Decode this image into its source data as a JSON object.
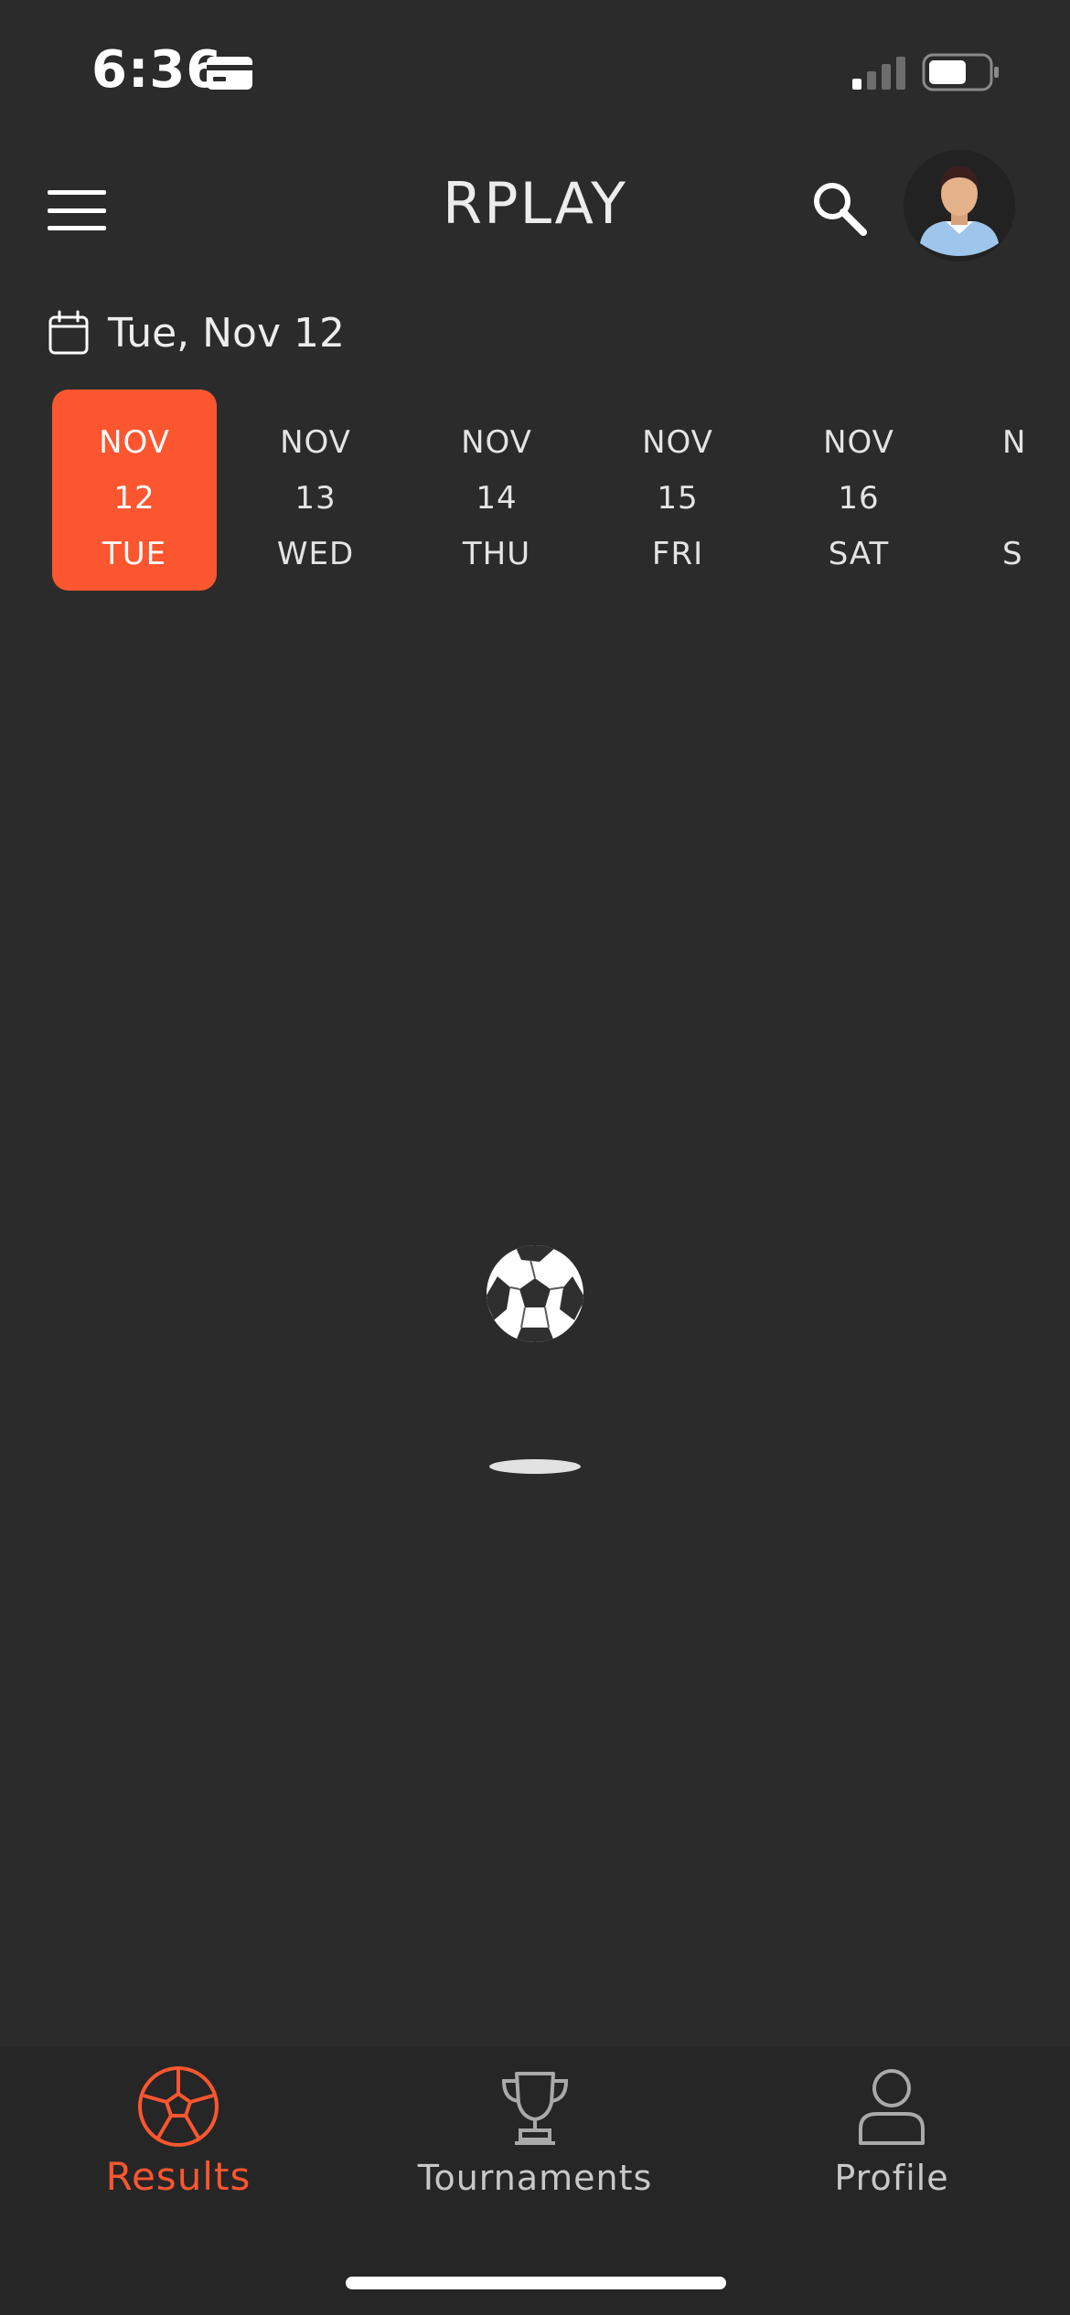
{
  "status_bar": {
    "time": "6:36",
    "card_icon": "card-icon",
    "signal_icon": "cellular-signal-icon",
    "battery_icon": "battery-icon",
    "battery_level": 0.65
  },
  "header": {
    "title": "RPLAY",
    "menu_icon": "hamburger-menu-icon",
    "search_icon": "search-icon",
    "avatar_icon": "user-avatar"
  },
  "date_picker": {
    "calendar_icon": "calendar-icon",
    "selected_date_label": "Tue, Nov 12",
    "days": [
      {
        "month": "NOV",
        "day": "12",
        "weekday": "TUE",
        "selected": true
      },
      {
        "month": "NOV",
        "day": "13",
        "weekday": "WED",
        "selected": false
      },
      {
        "month": "NOV",
        "day": "14",
        "weekday": "THU",
        "selected": false
      },
      {
        "month": "NOV",
        "day": "15",
        "weekday": "FRI",
        "selected": false
      },
      {
        "month": "NOV",
        "day": "16",
        "weekday": "SAT",
        "selected": false
      },
      {
        "month": "N",
        "day": "",
        "weekday": "S",
        "selected": false
      }
    ]
  },
  "loader": {
    "icon": "soccer-ball-icon"
  },
  "bottom_nav": {
    "items": [
      {
        "label": "Results",
        "icon": "soccer-ball-icon",
        "active": true
      },
      {
        "label": "Tournaments",
        "icon": "trophy-icon",
        "active": false
      },
      {
        "label": "Profile",
        "icon": "person-icon",
        "active": false
      }
    ]
  },
  "colors": {
    "background": "#2b2b2b",
    "accent": "#fb5630",
    "nav_background": "#262626",
    "text": "#e6e6e6"
  }
}
